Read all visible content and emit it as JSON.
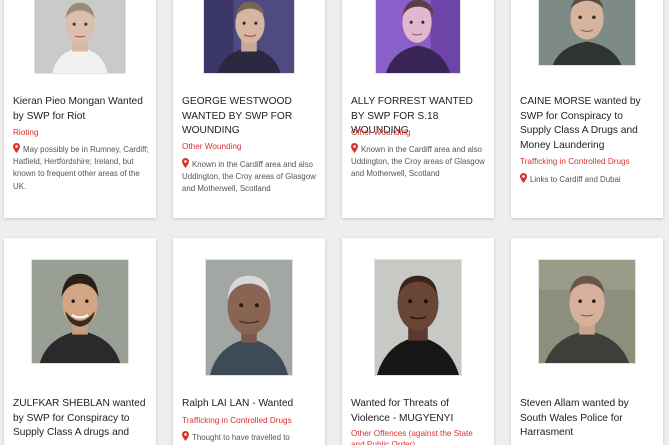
{
  "colors": {
    "accent": "#d9322e",
    "background": "#eeeeee",
    "card": "#ffffff"
  },
  "icons": {
    "location": "map-pin-icon"
  },
  "cards": [
    {
      "title": "Kieran Pieo Mongan Wanted by SWP for Riot",
      "crime": "Rioting",
      "location": "May possibly be in Rumney, Cardiff; Hatfield, Hertfordshire; Ireland, but known to frequent other areas of the UK."
    },
    {
      "title": "GEORGE WESTWOOD WANTED BY SWP FOR WOUNDING",
      "crime": "Other Wounding",
      "location": "Known in the Cardiff area and also Uddington, the Croy areas of Glasgow and Motherwell, Scotland"
    },
    {
      "title": "ALLY FORREST WANTED BY SWP FOR S.18 WOUNDING",
      "crime": "Other Wounding",
      "location": "Known in the Cardiff area and also Uddington, the Croy areas of Glasgow and Motherwell, Scotland"
    },
    {
      "title": "CAINE MORSE wanted by SWP for Conspiracy to Supply Class A Drugs and Money Laundering",
      "crime": "Trafficking in Controlled Drugs",
      "location": "Links to Cardiff and Dubai"
    },
    {
      "title": "ZULFKAR SHEBLAN wanted by SWP for Conspiracy to Supply Class A drugs and",
      "crime": "",
      "location": ""
    },
    {
      "title": "Ralph LAI LAN - Wanted",
      "crime": "Trafficking in Controlled Drugs",
      "location": "Thought to have travelled to"
    },
    {
      "title": "Wanted for Threats of Violence - MUGYENYI",
      "crime": "Other Offences (against the State and Public Order)",
      "location": ""
    },
    {
      "title": "Steven Allam wanted by South Wales Police for Harrasment",
      "crime": "",
      "location": ""
    }
  ]
}
